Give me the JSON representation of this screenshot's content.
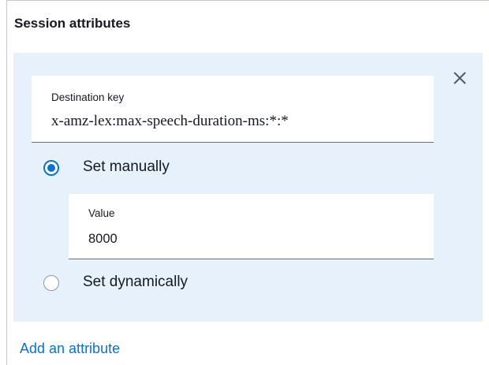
{
  "section": {
    "title": "Session attributes"
  },
  "attribute": {
    "destination_key_label": "Destination key",
    "destination_key_value": "x-amz-lex:max-speech-duration-ms:*:*",
    "options": [
      {
        "label": "Set manually",
        "selected": true
      },
      {
        "label": "Set dynamically",
        "selected": false
      }
    ],
    "value_label": "Value",
    "value": "8000",
    "close_icon": "close-icon"
  },
  "add_attribute_label": "Add an attribute",
  "colors": {
    "accent": "#0972d3",
    "card_background": "#e7f1fb",
    "text": "#16191f"
  }
}
